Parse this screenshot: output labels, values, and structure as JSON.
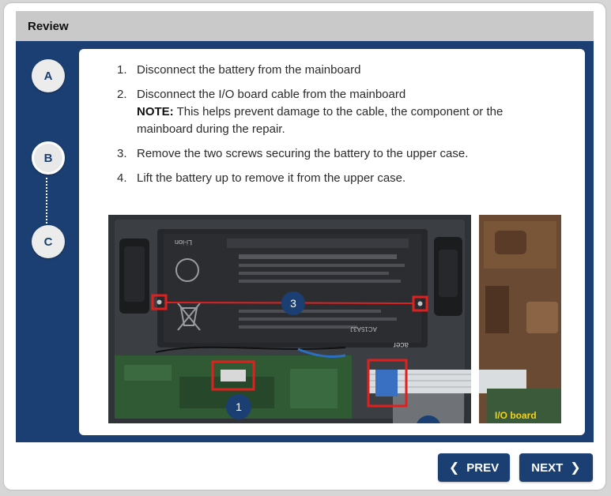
{
  "header": {
    "title": "Review"
  },
  "nav_steps": [
    {
      "label": "A",
      "active": false
    },
    {
      "label": "B",
      "active": true
    },
    {
      "label": "C",
      "active": false
    }
  ],
  "instructions": [
    {
      "num": "1.",
      "text": "Disconnect the battery from the mainboard"
    },
    {
      "num": "2.",
      "text": "Disconnect the I/O board cable from the mainboard",
      "note_label": "NOTE:",
      "note_text": " This helps prevent damage to the cable, the component or the mainboard during the repair."
    },
    {
      "num": "3.",
      "text": "Remove the two screws securing the battery to the upper case."
    },
    {
      "num": "4.",
      "text": "Lift the battery up to remove it from the upper case."
    }
  ],
  "photo": {
    "callouts": [
      "1",
      "3"
    ],
    "battery_brand": "acer",
    "battery_model": "AC15A3J",
    "battery_chem": "Li-ion",
    "side_label": "I/O board"
  },
  "footer": {
    "prev_label": "PREV",
    "next_label": "NEXT"
  },
  "colors": {
    "primary": "#1b3f73",
    "highlight": "#e01f1f",
    "side_label": "#f2d21b"
  }
}
